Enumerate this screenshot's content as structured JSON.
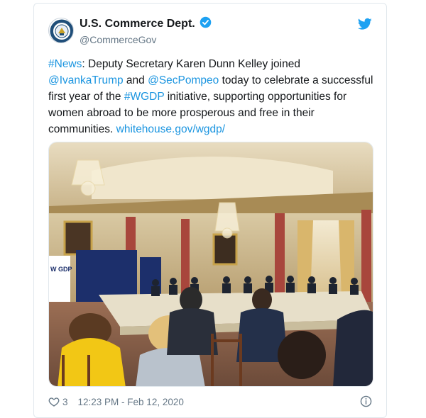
{
  "tweet": {
    "display_name": "U.S. Commerce Dept.",
    "handle": "@CommerceGov",
    "verified": true,
    "text": {
      "hashtag_news": "#News",
      "part1": ": Deputy Secretary Karen Dunn Kelley joined ",
      "mention1": "@IvankaTrump",
      "part2": " and ",
      "mention2": "@SecPompeo",
      "part3": " today to celebrate a successful first year of the ",
      "hashtag_wgdp": "#WGDP",
      "part4": " initiative, supporting opportunities for women abroad to be more prosperous and free in their communities. ",
      "url": "whitehouse.gov/wgdp/"
    },
    "like_count": "3",
    "timestamp": "12:23 PM - Feb 12, 2020",
    "banner_text": "W GDP"
  },
  "icons": {
    "bird": "twitter-bird-icon",
    "verified": "verified-badge-icon",
    "heart": "heart-icon",
    "info": "info-icon"
  },
  "colors": {
    "link": "#1b95e0",
    "secondary_text": "#657786",
    "verified": "#1da1f2",
    "border": "#e1e8ed"
  }
}
